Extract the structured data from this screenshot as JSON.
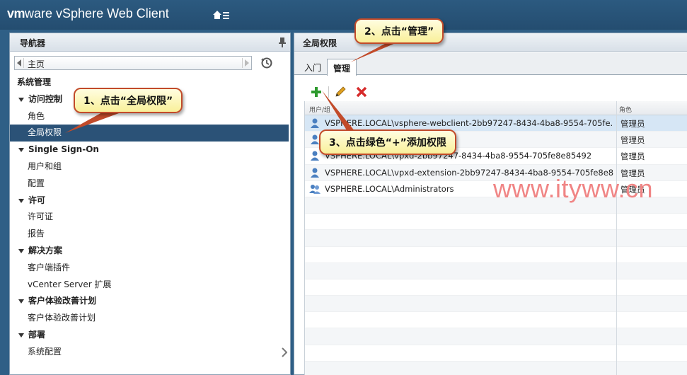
{
  "header": {
    "brand_vm": "vm",
    "brand_ware": "ware",
    "brand_product": " vSphere Web Client"
  },
  "navigator": {
    "title": "导航器",
    "history_label": "主页",
    "tree": [
      {
        "kind": "root",
        "label": "系统管理"
      },
      {
        "kind": "group",
        "label": "访问控制"
      },
      {
        "kind": "leaf",
        "label": "角色"
      },
      {
        "kind": "leaf",
        "label": "全局权限",
        "selected": true
      },
      {
        "kind": "group",
        "label": "Single Sign-On"
      },
      {
        "kind": "leaf",
        "label": "用户和组"
      },
      {
        "kind": "leaf",
        "label": "配置"
      },
      {
        "kind": "group",
        "label": "许可"
      },
      {
        "kind": "leaf",
        "label": "许可证"
      },
      {
        "kind": "leaf",
        "label": "报告"
      },
      {
        "kind": "group",
        "label": "解决方案"
      },
      {
        "kind": "leaf",
        "label": "客户端插件"
      },
      {
        "kind": "leaf",
        "label": "vCenter Server 扩展"
      },
      {
        "kind": "group",
        "label": "客户体验改善计划"
      },
      {
        "kind": "leaf",
        "label": "客户体验改善计划"
      },
      {
        "kind": "group",
        "label": "部署"
      },
      {
        "kind": "leaf",
        "label": "系统配置"
      }
    ]
  },
  "main": {
    "title": "全局权限",
    "tabs": [
      {
        "label": "入门",
        "active": false
      },
      {
        "label": "管理",
        "active": true
      }
    ],
    "grid": {
      "columns": [
        "用户/组",
        "角色"
      ],
      "rows": [
        {
          "user": "VSPHERE.LOCAL\\vsphere-webclient-2bb97247-8434-4ba8-9554-705fe...",
          "role": "管理员",
          "icon": "user-icon",
          "selected": true
        },
        {
          "user": "",
          "role": "管理员",
          "icon": "user-icon"
        },
        {
          "user": "VSPHERE.LOCAL\\vpxd-2bb97247-8434-4ba8-9554-705fe8e85492",
          "role": "管理员",
          "icon": "user-icon"
        },
        {
          "user": "VSPHERE.LOCAL\\vpxd-extension-2bb97247-8434-4ba8-9554-705fe8e8...",
          "role": "管理员",
          "icon": "user-icon"
        },
        {
          "user": "VSPHERE.LOCAL\\Administrators",
          "role": "管理员",
          "icon": "group-icon"
        },
        {
          "user": "",
          "role": ""
        },
        {
          "user": "",
          "role": ""
        },
        {
          "user": "",
          "role": ""
        },
        {
          "user": "",
          "role": ""
        },
        {
          "user": "",
          "role": ""
        },
        {
          "user": "",
          "role": ""
        },
        {
          "user": "",
          "role": ""
        },
        {
          "user": "",
          "role": ""
        },
        {
          "user": "",
          "role": ""
        },
        {
          "user": "",
          "role": ""
        },
        {
          "user": "",
          "role": ""
        }
      ]
    }
  },
  "callouts": {
    "c1": "1、点击“全局权限”",
    "c2": "2、点击“管理”",
    "c3": "3、点击绿色“+”添加权限"
  },
  "watermark": "www.ityww.cn",
  "colors": {
    "header_bg": "#2c5a80",
    "selection": "#2b5277",
    "callout_border": "#c24b2a",
    "add_icon": "#2e9a2e",
    "delete_icon": "#d62b2b"
  }
}
